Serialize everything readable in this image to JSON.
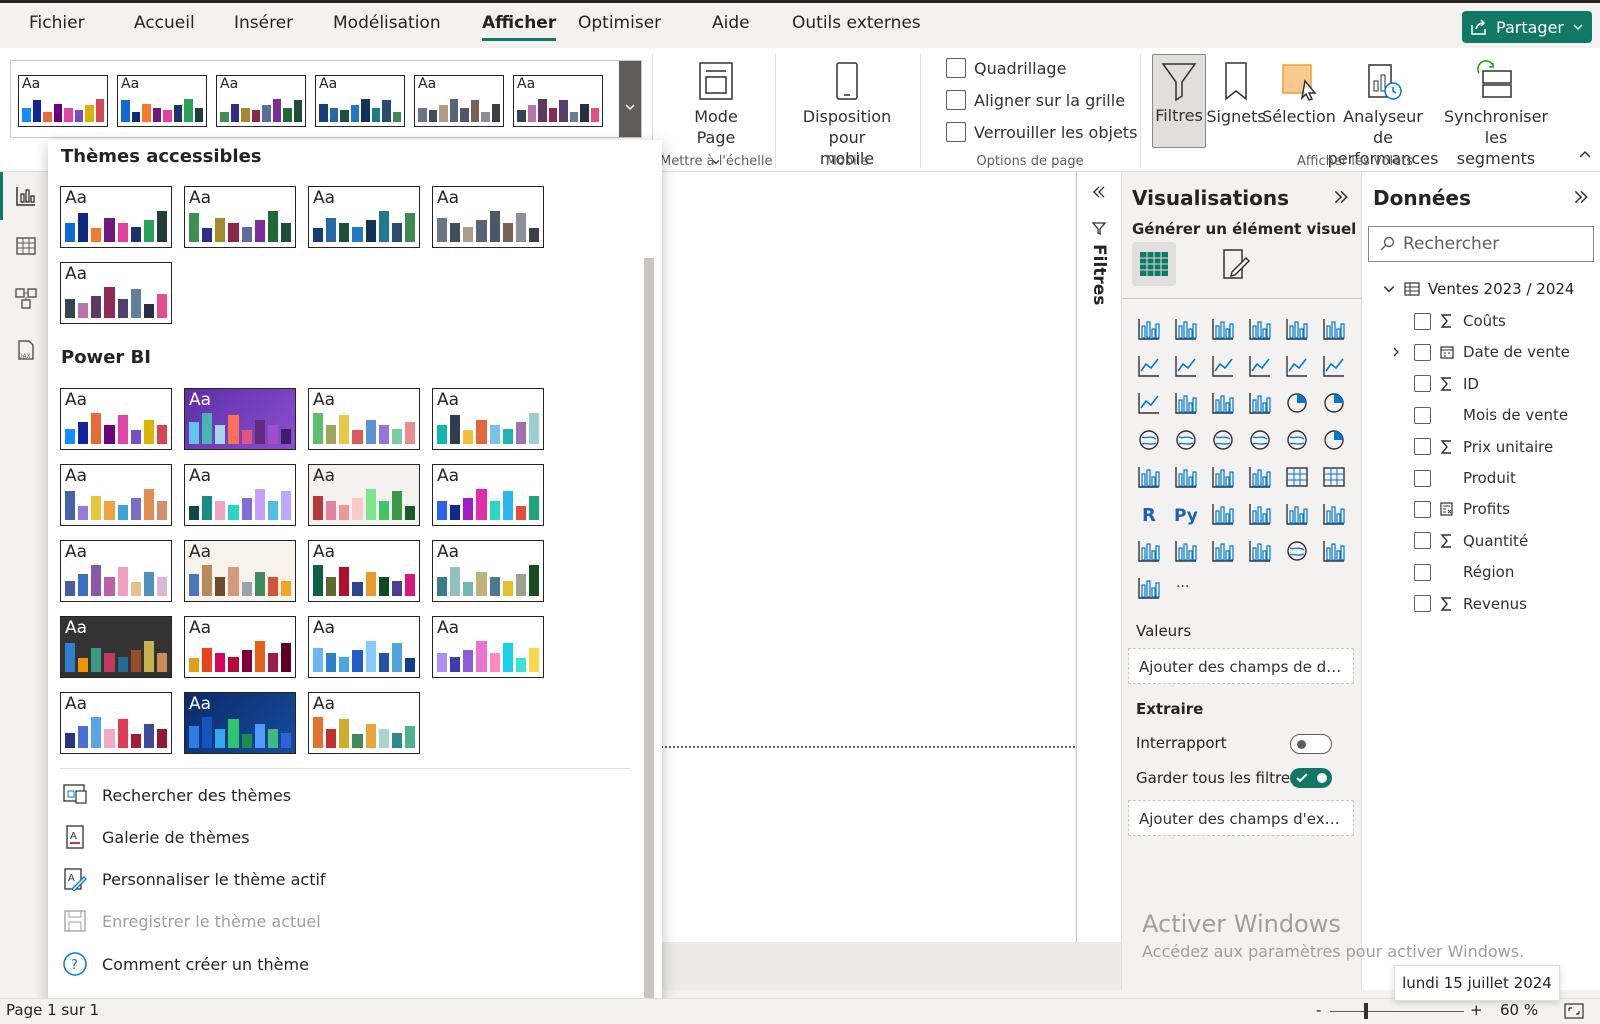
{
  "menu": {
    "items": [
      "Fichier",
      "Accueil",
      "Insérer",
      "Modélisation",
      "Afficher",
      "Optimiser",
      "Aide",
      "Outils externes"
    ],
    "active_index": 4,
    "share_label": "Partager"
  },
  "ribbon": {
    "mode_page": {
      "line1": "Mode",
      "line2": "Page"
    },
    "scale_group": "Mettre à l'échelle",
    "mobile": {
      "line1": "Disposition pour",
      "line2": "mobile",
      "group": "Mobile"
    },
    "page_options": {
      "grid": "Quadrillage",
      "snap": "Aligner sur la grille",
      "lock": "Verrouiller les objets",
      "group": "Options de page"
    },
    "panes": {
      "filters": "Filtres",
      "bookmarks": "Signets",
      "selection": "Sélection",
      "perf_line1": "Analyseur de",
      "perf_line2": "performances",
      "sync_line1": "Synchroniser les",
      "sync_line2": "segments",
      "group": "Afficher les volets"
    }
  },
  "themes_panel": {
    "accessible_title": "Thèmes accessibles",
    "powerbi_title": "Power BI",
    "card_label": "Aa",
    "menu": {
      "browse": "Rechercher des thèmes",
      "gallery": "Galerie de thèmes",
      "customize": "Personnaliser le thème actif",
      "save": "Enregistrer le thème actuel",
      "howto": "Comment créer un thème"
    }
  },
  "filters_strip": {
    "label": "Filtres"
  },
  "visualizations": {
    "title": "Visualisations",
    "build_label": "Générer un élément visuel",
    "values_label": "Valeurs",
    "values_drop": "Ajouter des champs de don...",
    "drill_label": "Extraire",
    "cross_report": "Interrapport",
    "keep_filters": "Garder tous les filtres",
    "drill_drop": "Ajouter des champs d'extr...",
    "more": "···",
    "r_label": "R",
    "py_label": "Py"
  },
  "data_pane": {
    "title": "Données",
    "search_placeholder": "Rechercher",
    "table_name": "Ventes 2023 / 2024",
    "fields": [
      "Coûts",
      "Date de vente",
      "ID",
      "Mois de vente",
      "Prix unitaire",
      "Produit",
      "Profits",
      "Quantité",
      "Région",
      "Revenus"
    ]
  },
  "status": {
    "page": "Page 1 sur 1",
    "zoom": "60 %",
    "zoom_minus": "-",
    "zoom_plus": "+"
  },
  "watermark": {
    "title": "Activer Windows",
    "subtitle": "Accédez aux paramètres pour activer Windows."
  },
  "date_tooltip": "lundi 15 juillet 2024",
  "colors": {
    "accent": "#117865",
    "menu_bg": "#f3f2f1"
  }
}
